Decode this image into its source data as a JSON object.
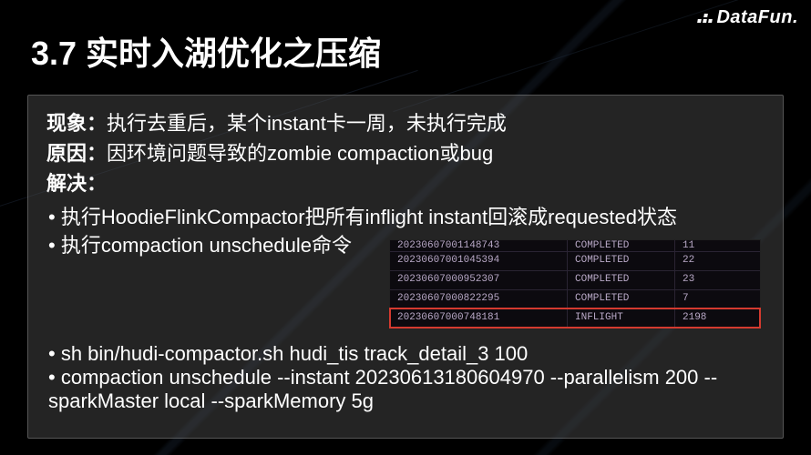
{
  "brand": "DataFun.",
  "title": "3.7 实时入湖优化之压缩",
  "labels": {
    "phenomenon": "现象：",
    "cause": "原因：",
    "solution": "解决："
  },
  "phenomenon_text": "执行去重后，某个instant卡一周，未执行完成",
  "cause_text": "因环境问题导致的zombie compaction或bug",
  "bullets": [
    "执行HoodieFlinkCompactor把所有inflight instant回滚成requested状态",
    "执行compaction unschedule命令"
  ],
  "commands": [
    "sh bin/hudi-compactor.sh hudi_tis track_detail_3 100",
    "compaction unschedule --instant 20230613180604970  --parallelism 200 --sparkMaster local --sparkMemory 5g"
  ],
  "table": {
    "rows": [
      {
        "instant": "20230607001148743",
        "status": "COMPLETED",
        "count": "11",
        "partial": true,
        "highlight": false
      },
      {
        "instant": "20230607001045394",
        "status": "COMPLETED",
        "count": "22",
        "partial": false,
        "highlight": false
      },
      {
        "instant": "20230607000952307",
        "status": "COMPLETED",
        "count": "23",
        "partial": false,
        "highlight": false
      },
      {
        "instant": "20230607000822295",
        "status": "COMPLETED",
        "count": "7",
        "partial": false,
        "highlight": false
      },
      {
        "instant": "20230607000748181",
        "status": "INFLIGHT",
        "count": "2198",
        "partial": false,
        "highlight": true
      }
    ]
  }
}
